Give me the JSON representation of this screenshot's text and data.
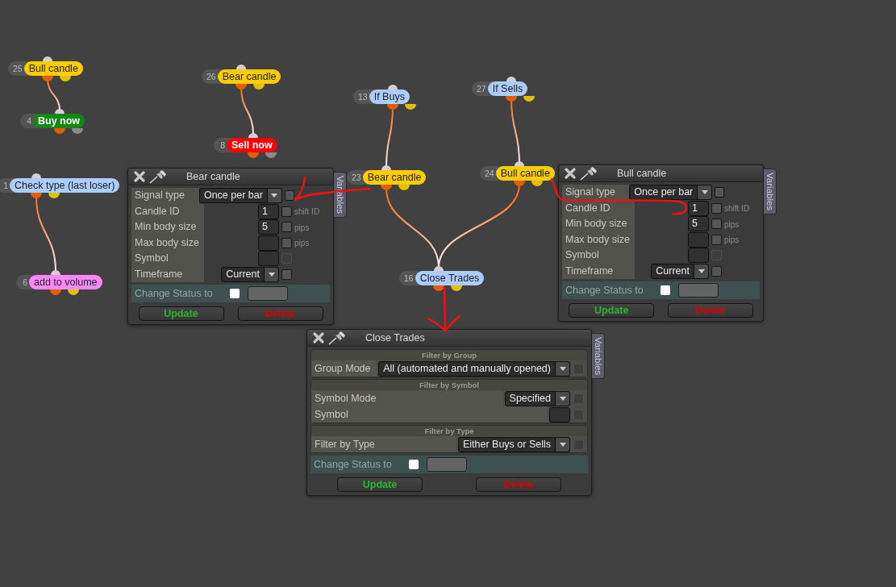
{
  "nodes": [
    {
      "number": "25",
      "label": "Bull candle",
      "kind": "condition",
      "color": "#ffcc00"
    },
    {
      "number": "26",
      "label": "Bear candle",
      "kind": "condition",
      "color": "#ffcc00"
    },
    {
      "number": "4",
      "label": "Buy now",
      "kind": "action",
      "color": "#118811"
    },
    {
      "number": "8",
      "label": "Sell now",
      "kind": "action",
      "color": "#ff0000"
    },
    {
      "number": "1",
      "label": "Check type (last loser)",
      "kind": "condition",
      "color": "#aaccff"
    },
    {
      "number": "6",
      "label": "add to volume",
      "kind": "condition",
      "color": "#ff88ff"
    },
    {
      "number": "13",
      "label": "If Buys",
      "kind": "condition",
      "color": "#aaccff"
    },
    {
      "number": "27",
      "label": "If Sells",
      "kind": "condition",
      "color": "#aaccff"
    },
    {
      "number": "23",
      "label": "Bear candle",
      "kind": "condition",
      "color": "#ffcc00"
    },
    {
      "number": "24",
      "label": "Bull candle",
      "kind": "condition",
      "color": "#ffcc00"
    },
    {
      "number": "16",
      "label": "Close Trades",
      "kind": "condition",
      "color": "#aaccff"
    }
  ],
  "panels": [
    {
      "title": "Bear candle",
      "tab": "Variables",
      "rows": [
        {
          "label": "Signal type",
          "kind": "select",
          "value": "Once per bar",
          "disabled": false
        },
        {
          "label": "Candle ID",
          "kind": "input",
          "value": "1",
          "note": "shift ID",
          "disabled": false
        },
        {
          "label": "Min body size",
          "kind": "input",
          "value": "5",
          "note": "pips",
          "disabled": false
        },
        {
          "label": "Max body size",
          "kind": "input",
          "note": "pips",
          "disabled": false
        },
        {
          "label": "Symbol",
          "kind": "input",
          "disabled": true
        },
        {
          "label": "Timeframe",
          "kind": "select",
          "value": "Current",
          "disabled": false
        }
      ],
      "status": {
        "label": "Change Status to",
        "checked": false
      },
      "buttons": [
        {
          "label": "Update",
          "kind": "update"
        },
        {
          "label": "Delete",
          "kind": "delete"
        }
      ]
    },
    {
      "title": "Bull candle",
      "tab": "Variables",
      "rows": [
        {
          "label": "Signal type",
          "kind": "select",
          "value": "Once per bar",
          "disabled": false
        },
        {
          "label": "Candle ID",
          "kind": "input",
          "value": "1",
          "note": "shift ID",
          "disabled": false
        },
        {
          "label": "Min body size",
          "kind": "input",
          "value": "5",
          "note": "pips",
          "disabled": false
        },
        {
          "label": "Max body size",
          "kind": "input",
          "note": "pips",
          "disabled": false
        },
        {
          "label": "Symbol",
          "kind": "input",
          "disabled": true
        },
        {
          "label": "Timeframe",
          "kind": "select",
          "value": "Current",
          "disabled": false
        }
      ],
      "status": {
        "label": "Change Status to",
        "checked": false
      },
      "buttons": [
        {
          "label": "Update",
          "kind": "update"
        },
        {
          "label": "Delete",
          "kind": "delete"
        }
      ]
    },
    {
      "title": "Close Trades",
      "tab": "Variables",
      "sections": [
        {
          "heading": "Filter by Group",
          "rows": [
            {
              "label": "Group Mode",
              "kind": "select",
              "value": "All (automated and manually opened)",
              "disabled": true
            }
          ]
        },
        {
          "heading": "Filter by Symbol",
          "rows": [
            {
              "label": "Symbol Mode",
              "kind": "select",
              "value": "Specified",
              "disabled": true
            },
            {
              "label": "Symbol",
              "kind": "input",
              "disabled": true
            }
          ]
        },
        {
          "heading": "Filter by Type",
          "rows": [
            {
              "label": "Filter by Type",
              "kind": "select",
              "value": "Either Buys or Sells",
              "disabled": true
            }
          ]
        }
      ],
      "status": {
        "label": "Change Status to",
        "checked": false
      },
      "buttons": [
        {
          "label": "Update",
          "kind": "update"
        },
        {
          "label": "Delete",
          "kind": "delete"
        }
      ]
    }
  ]
}
